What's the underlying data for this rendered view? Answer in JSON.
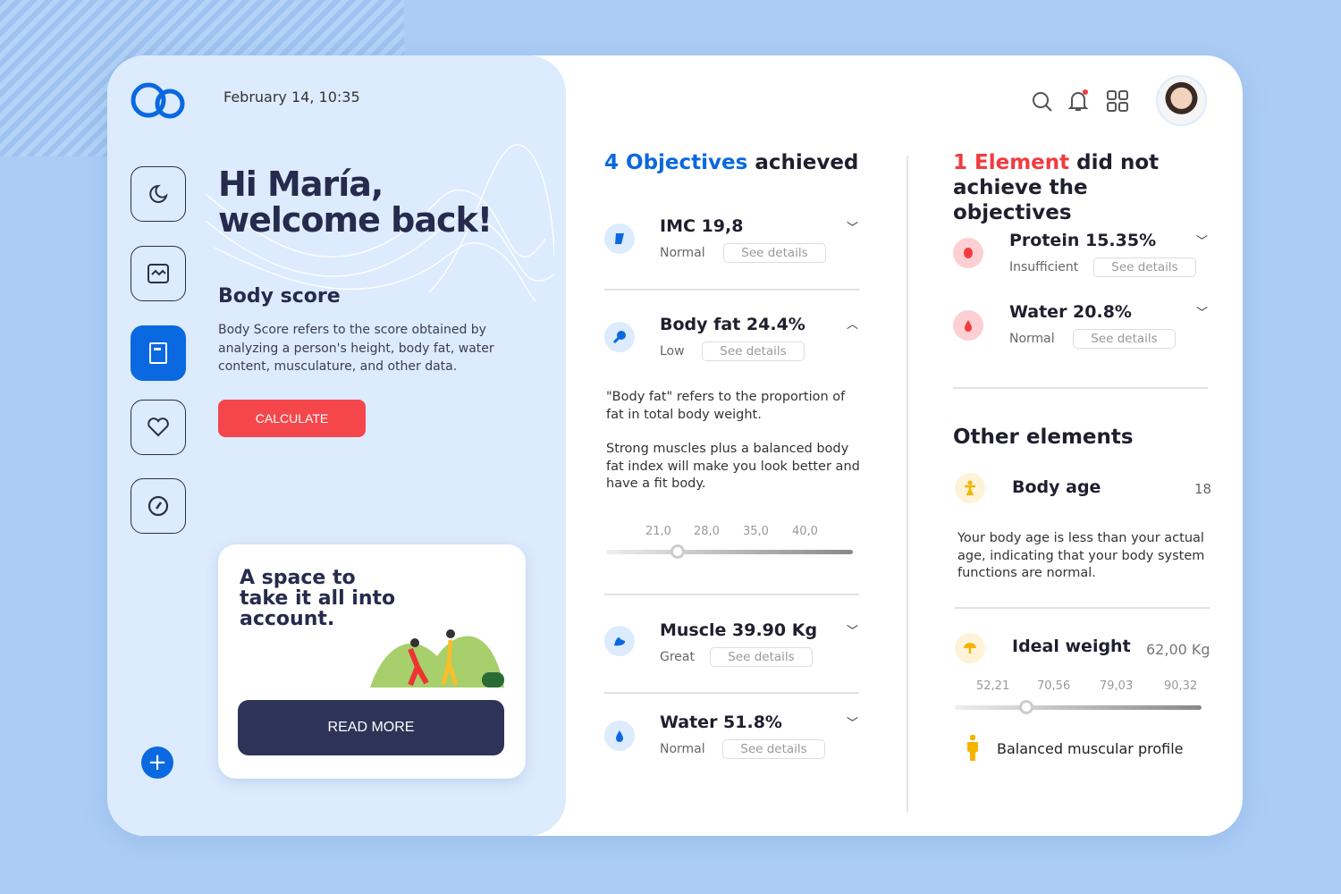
{
  "header": {
    "date": "February 14, 10:35",
    "icons": [
      "search-icon",
      "bell-icon",
      "grid-icon",
      "avatar"
    ]
  },
  "sidebar": {
    "items": [
      "sleep-icon",
      "activity-icon",
      "report-icon",
      "heart-icon",
      "gauge-icon"
    ],
    "active": 2
  },
  "welcome": {
    "line1": "Hi María,",
    "line2": "welcome back!"
  },
  "body_score": {
    "title": "Body score",
    "text": "Body Score refers to the score obtained by analyzing a person's height, body fat, water content, musculature, and other data.",
    "button": "CALCULATE"
  },
  "promo": {
    "title": "A space to take it all into account.",
    "button": "READ MORE"
  },
  "objectives": {
    "count": "4 Objectives",
    "rest": " achieved",
    "items": [
      {
        "title": "IMC 19,8",
        "status": "Normal",
        "details": "See details"
      },
      {
        "title": "Body fat 24.4%",
        "status": "Low",
        "details": "See details",
        "text1": "\"Body fat\" refers to the proportion of fat in total body weight.",
        "text2": "Strong muscles plus a balanced body fat index will make you look better and have a fit body.",
        "ticks": [
          "21,0",
          "28,0",
          "35,0",
          "40,0"
        ],
        "value_fraction": 0.29
      },
      {
        "title": "Muscle 39.90 Kg",
        "status": "Great",
        "details": "See details"
      },
      {
        "title": "Water 51.8%",
        "status": "Normal",
        "details": "See details"
      }
    ]
  },
  "failed": {
    "count": "1 Element",
    "rest": " did not achieve the objectives",
    "items": [
      {
        "title": "Protein 15.35%",
        "status": "Insufficient",
        "details": "See details"
      },
      {
        "title": "Water 20.8%",
        "status": "Normal",
        "details": "See details"
      }
    ]
  },
  "other": {
    "title": "Other elements",
    "body_age": {
      "label": "Body age",
      "value": "18",
      "text": "Your body age is less than your actual age, indicating that your body system functions are normal."
    },
    "ideal_weight": {
      "label": "Ideal weight",
      "value": "62,00 Kg",
      "ticks": [
        "52,21",
        "70,56",
        "79,03",
        "90,32"
      ],
      "value_fraction": 0.29
    },
    "profile": "Balanced muscular profile"
  },
  "colors": {
    "accent": "#0a68e0",
    "danger": "#f23b3f",
    "navy": "#2d3457",
    "background": "#abcdf5"
  }
}
